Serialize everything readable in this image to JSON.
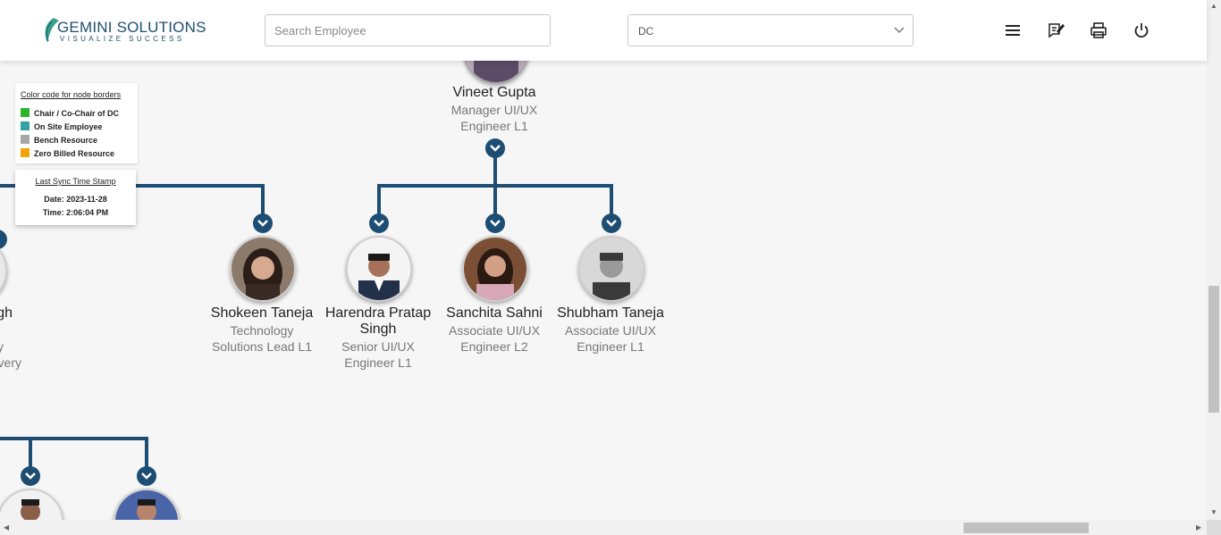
{
  "header": {
    "logo_main": "GEMINI SOLUTIONS",
    "logo_tagline": "VISUALIZE SUCCESS",
    "search_placeholder": "Search Employee",
    "dc_selected": "DC",
    "icons": [
      "menu-icon",
      "feedback-icon",
      "print-icon",
      "power-icon"
    ]
  },
  "legend": {
    "title": "Color code for node borders",
    "items": [
      {
        "label": "Chair / Co-Chair of DC",
        "color": "#2bb52b"
      },
      {
        "label": "On Site Employee",
        "color": "#33a3a3"
      },
      {
        "label": "Bench Resource",
        "color": "#a6a6a6"
      },
      {
        "label": "Zero Billed Resource",
        "color": "#f0a30a"
      }
    ]
  },
  "sync": {
    "title": "Last Sync Time Stamp",
    "date": "Date: 2023-11-28",
    "time": "Time: 2:06:04 PM"
  },
  "tree": {
    "manager": {
      "name": "Vineet Gupta",
      "role": [
        "Manager UI/UX",
        "Engineer L1"
      ]
    },
    "children": [
      {
        "name": "Shokeen Taneja",
        "role": [
          "Technology",
          "Solutions Lead L1"
        ]
      },
      {
        "name": "Harendra Pratap Singh",
        "role": [
          "Senior UI/UX",
          "Engineer L1"
        ]
      },
      {
        "name": "Sanchita Sahni",
        "role": [
          "Associate UI/UX",
          "Engineer L2"
        ]
      },
      {
        "name": "Shubham Taneja",
        "role": [
          "Associate UI/UX",
          "Engineer L1"
        ]
      }
    ],
    "partial_left": {
      "name_fragment": "gh",
      "role_fragments": [
        "y",
        "very"
      ]
    }
  },
  "colors": {
    "accent": "#1d4d72",
    "brand": "#1f4e6e"
  }
}
